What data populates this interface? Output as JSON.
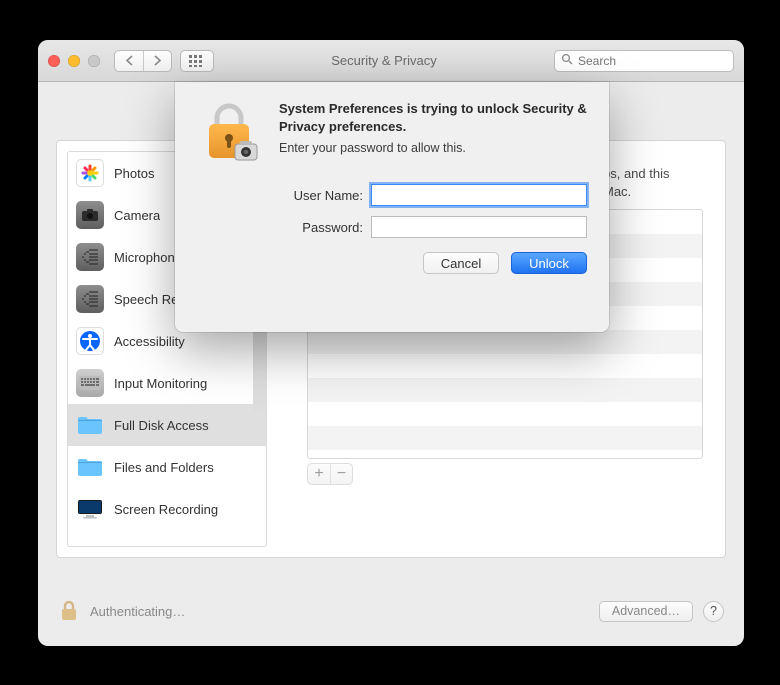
{
  "window": {
    "title": "Security & Privacy"
  },
  "toolbar": {
    "search_placeholder": "Search"
  },
  "sidebar": {
    "items": [
      {
        "label": "Photos"
      },
      {
        "label": "Camera"
      },
      {
        "label": "Microphone"
      },
      {
        "label": "Speech Recognition"
      },
      {
        "label": "Accessibility"
      },
      {
        "label": "Input Monitoring"
      },
      {
        "label": "Full Disk Access"
      },
      {
        "label": "Files and Folders"
      },
      {
        "label": "Screen Recording"
      }
    ],
    "selected_index": 6
  },
  "right_hint_text": "ps, and this Mac.",
  "footer": {
    "status": "Authenticating…",
    "advanced_label": "Advanced…",
    "help_label": "?"
  },
  "auth": {
    "heading": "System Preferences is trying to unlock Security & Privacy preferences.",
    "subtext": "Enter your password to allow this.",
    "username_label": "User Name:",
    "password_label": "Password:",
    "username_value": "",
    "password_value": "",
    "cancel_label": "Cancel",
    "unlock_label": "Unlock"
  }
}
